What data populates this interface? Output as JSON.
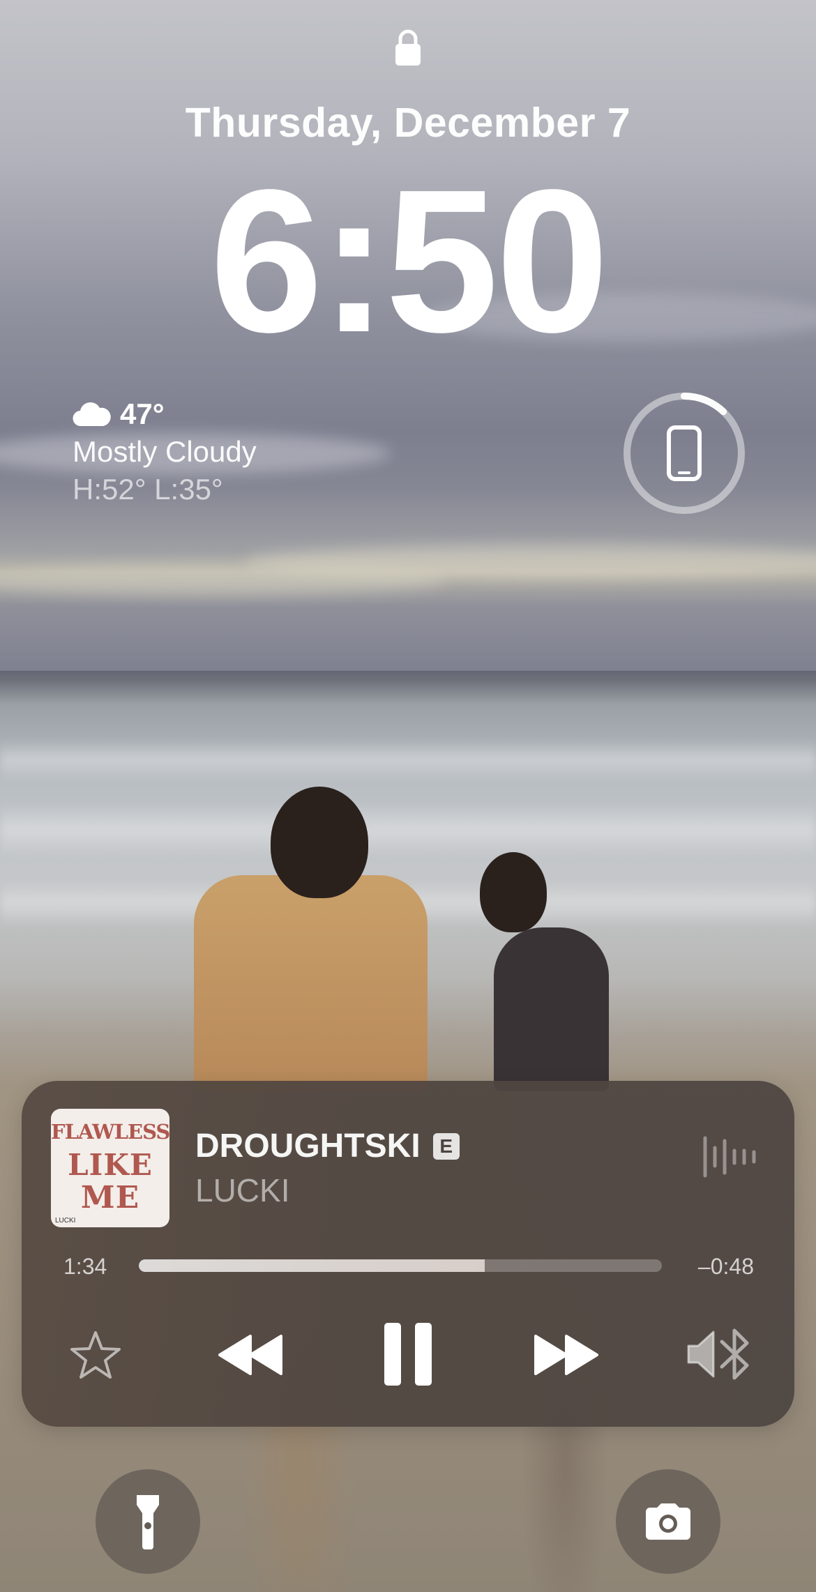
{
  "lockscreen": {
    "date": "Thursday, December 7",
    "time": "6:50"
  },
  "weather": {
    "icon": "cloud-icon",
    "temperature": "47°",
    "condition": "Mostly Cloudy",
    "high_low": "H:52° L:35°"
  },
  "battery_widget": {
    "icon": "iphone-icon",
    "charge_fraction": 0.12
  },
  "now_playing": {
    "album_art": {
      "line1": "FLAWLESS",
      "line2": "LIKE",
      "line3": "ME",
      "artist_tag": "LUCKI"
    },
    "title": "DROUGHTSKI",
    "explicit_badge": "E",
    "artist": "LUCKI",
    "elapsed": "1:34",
    "remaining": "–0:48",
    "progress_fraction": 0.662,
    "controls": [
      "star-icon",
      "rewind-icon",
      "pause-icon",
      "fast-forward-icon",
      "speaker-bluetooth-icon"
    ]
  },
  "quick_actions": {
    "left": "flashlight-icon",
    "right": "camera-icon"
  }
}
